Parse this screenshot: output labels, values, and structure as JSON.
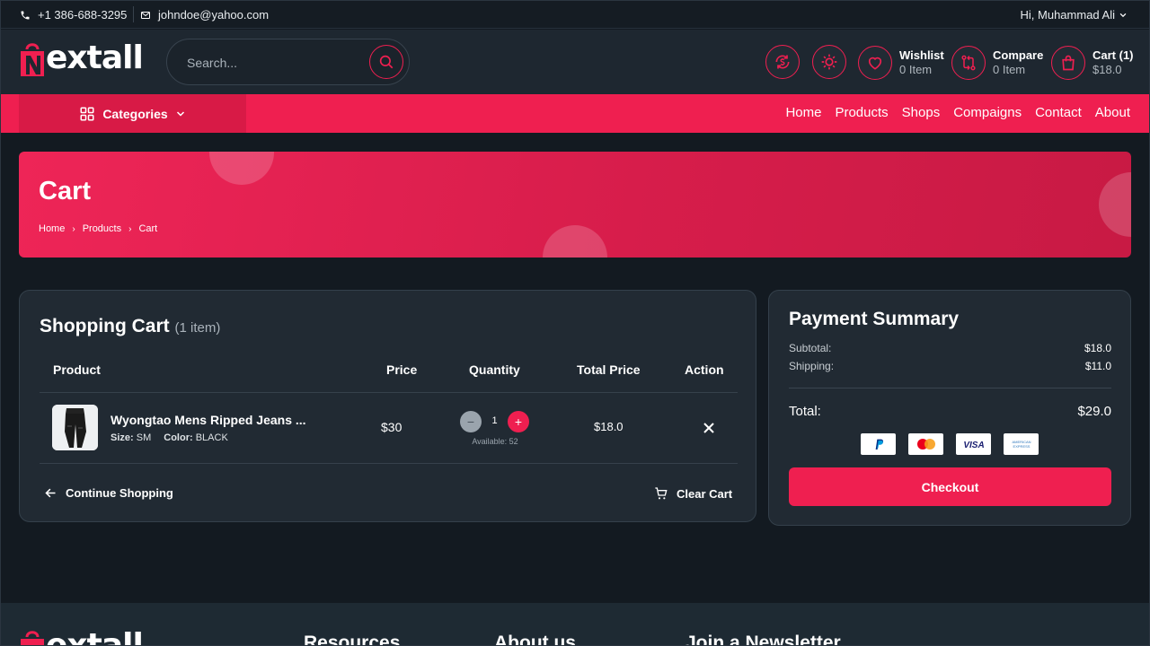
{
  "topbar": {
    "phone": "+1 386-688-3295",
    "email": "johndoe@yahoo.com",
    "greeting": "Hi, Muhammad Ali"
  },
  "header": {
    "logo_text": "extall",
    "search_placeholder": "Search...",
    "wishlist": {
      "label": "Wishlist",
      "count": "0 Item"
    },
    "compare": {
      "label": "Compare",
      "count": "0 Item"
    },
    "cart": {
      "label": "Cart (1)",
      "amount": "$18.0"
    }
  },
  "nav": {
    "categories": "Categories",
    "links": [
      "Home",
      "Products",
      "Shops",
      "Compaigns",
      "Contact",
      "About"
    ]
  },
  "hero": {
    "title": "Cart",
    "breadcrumb": [
      "Home",
      "Products",
      "Cart"
    ]
  },
  "cart": {
    "title": "Shopping Cart",
    "count": "(1 item)",
    "columns": [
      "Product",
      "Price",
      "Quantity",
      "Total Price",
      "Action"
    ],
    "item": {
      "name": "Wyongtao Mens Ripped Jeans ...",
      "size_label": "Size:",
      "size": "SM",
      "color_label": "Color:",
      "color": "BLACK",
      "price": "$30",
      "quantity": "1",
      "minus": "−",
      "plus": "+",
      "available": "Available: 52",
      "total": "$18.0"
    },
    "continue": "Continue Shopping",
    "clear": "Clear Cart"
  },
  "payment": {
    "title": "Payment Summary",
    "subtotal_label": "Subtotal:",
    "subtotal": "$18.0",
    "shipping_label": "Shipping:",
    "shipping": "$11.0",
    "total_label": "Total:",
    "total": "$29.0",
    "methods": [
      "PayPal",
      "Mastercard",
      "VISA",
      "AMERICAN EXPRESS"
    ],
    "checkout": "Checkout"
  },
  "footer": {
    "logo_text": "extall",
    "headings": [
      "Resources",
      "About us",
      "Join a Newsletter"
    ]
  },
  "colors": {
    "accent": "#ef1f50",
    "background": "#131a21",
    "card": "#212a33"
  }
}
